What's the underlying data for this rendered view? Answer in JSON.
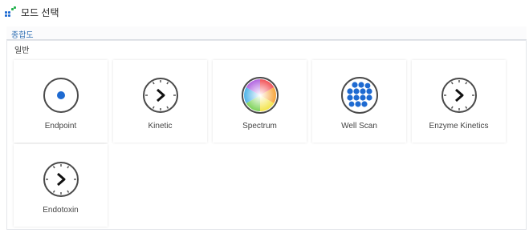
{
  "window": {
    "title": "모드 선택"
  },
  "tabs": [
    {
      "label": "종합도"
    }
  ],
  "section": {
    "label": "일반"
  },
  "colors": {
    "tab_text": "#2f6fb3",
    "accent_blue": "#1e6ad1",
    "border": "#d9dde3"
  },
  "modes": [
    {
      "label": "Endpoint",
      "icon": "endpoint-dot-icon"
    },
    {
      "label": "Kinetic",
      "icon": "clock-icon"
    },
    {
      "label": "Spectrum",
      "icon": "color-wheel-icon"
    },
    {
      "label": "Well Scan",
      "icon": "dot-grid-icon"
    },
    {
      "label": "Enzyme Kinetics",
      "icon": "clock-icon"
    },
    {
      "label": "Endotoxin",
      "icon": "clock-icon"
    }
  ]
}
